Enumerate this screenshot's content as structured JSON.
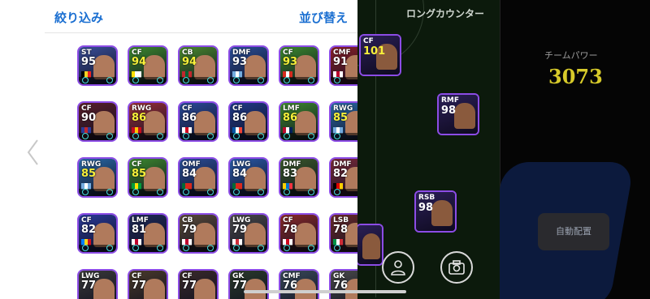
{
  "header": {
    "filter_label": "絞り込み",
    "sort_label": "並び替え"
  },
  "pitch": {
    "title": "ロングカウンター"
  },
  "team": {
    "label": "チームパワー",
    "value": "3073",
    "auto_label": "自動配置"
  },
  "cards": [
    {
      "pos": "ST",
      "rating": "95",
      "hi": false,
      "bg": "#3a4f9a",
      "flag": "be"
    },
    {
      "pos": "CF",
      "rating": "94",
      "hi": true,
      "bg": "#3c8a2e",
      "flag": "vat"
    },
    {
      "pos": "CB",
      "rating": "94",
      "hi": true,
      "bg": "#4a8a2e",
      "flag": "ma"
    },
    {
      "pos": "DMF",
      "rating": "93",
      "hi": false,
      "bg": "#2a4f9a",
      "flag": "ar"
    },
    {
      "pos": "CF",
      "rating": "93",
      "hi": true,
      "bg": "#3c8a2e",
      "flag": "ca"
    },
    {
      "pos": "CMF",
      "rating": "91",
      "hi": false,
      "bg": "#8a1f2a",
      "flag": "jp"
    },
    {
      "pos": "CF",
      "rating": "90",
      "hi": false,
      "bg": "#5a1f2a",
      "flag": "fc"
    },
    {
      "pos": "RWG",
      "rating": "86",
      "hi": true,
      "bg": "#9a2f3a",
      "flag": "es"
    },
    {
      "pos": "CF",
      "rating": "86",
      "hi": false,
      "bg": "#2a4a9a",
      "flag": "en"
    },
    {
      "pos": "CF",
      "rating": "86",
      "hi": false,
      "bg": "#1f3a8a",
      "flag": "fr"
    },
    {
      "pos": "LMF",
      "rating": "86",
      "hi": true,
      "bg": "#3c8a2e",
      "flag": "no"
    },
    {
      "pos": "RWG",
      "rating": "85",
      "hi": true,
      "bg": "#2a6aaa",
      "flag": "ar"
    },
    {
      "pos": "RWG",
      "rating": "85",
      "hi": true,
      "bg": "#2a6aaa",
      "flag": "ar"
    },
    {
      "pos": "CF",
      "rating": "85",
      "hi": true,
      "bg": "#3c8a2e",
      "flag": "br"
    },
    {
      "pos": "OMF",
      "rating": "84",
      "hi": false,
      "bg": "#2a4f9a",
      "flag": "pt"
    },
    {
      "pos": "LWG",
      "rating": "84",
      "hi": false,
      "bg": "#2a5aaa",
      "flag": "pt"
    },
    {
      "pos": "DMF",
      "rating": "83",
      "hi": false,
      "bg": "#3a5a2a",
      "flag": "ec"
    },
    {
      "pos": "DMF",
      "rating": "82",
      "hi": false,
      "bg": "#7a2a3a",
      "flag": "de"
    },
    {
      "pos": "CF",
      "rating": "82",
      "hi": false,
      "bg": "#2a3a9a",
      "flag": "cd"
    },
    {
      "pos": "LMF",
      "rating": "81",
      "hi": false,
      "bg": "#1f2a5a",
      "flag": "jp"
    },
    {
      "pos": "CB",
      "rating": "79",
      "hi": false,
      "bg": "#5a4a3a",
      "flag": "jp"
    },
    {
      "pos": "LWG",
      "rating": "79",
      "hi": false,
      "bg": "#4a4a4a",
      "flag": "kr"
    },
    {
      "pos": "CF",
      "rating": "78",
      "hi": false,
      "bg": "#8a2a2a",
      "flag": "en"
    },
    {
      "pos": "LSB",
      "rating": "78",
      "hi": false,
      "bg": "#6a2a2a",
      "flag": "it"
    },
    {
      "pos": "LWG",
      "rating": "77",
      "hi": false,
      "bg": "#3a3a3a",
      "flag": ""
    },
    {
      "pos": "CF",
      "rating": "77",
      "hi": false,
      "bg": "#4a3a2a",
      "flag": ""
    },
    {
      "pos": "CF",
      "rating": "77",
      "hi": false,
      "bg": "#3a2a2a",
      "flag": ""
    },
    {
      "pos": "GK",
      "rating": "77",
      "hi": false,
      "bg": "#2a3a2a",
      "flag": ""
    },
    {
      "pos": "CMF",
      "rating": "76",
      "hi": false,
      "bg": "#3a4a5a",
      "flag": ""
    },
    {
      "pos": "GK",
      "rating": "76",
      "hi": false,
      "bg": "#4a4a4a",
      "flag": ""
    }
  ],
  "pitch_cards": [
    {
      "pos": "CF",
      "rating": "101",
      "hi": true
    },
    {
      "pos": "RMF",
      "rating": "98",
      "hi": false
    },
    {
      "pos": "RSB",
      "rating": "98",
      "hi": false
    },
    {
      "pos": "",
      "rating": "",
      "hi": false
    }
  ]
}
